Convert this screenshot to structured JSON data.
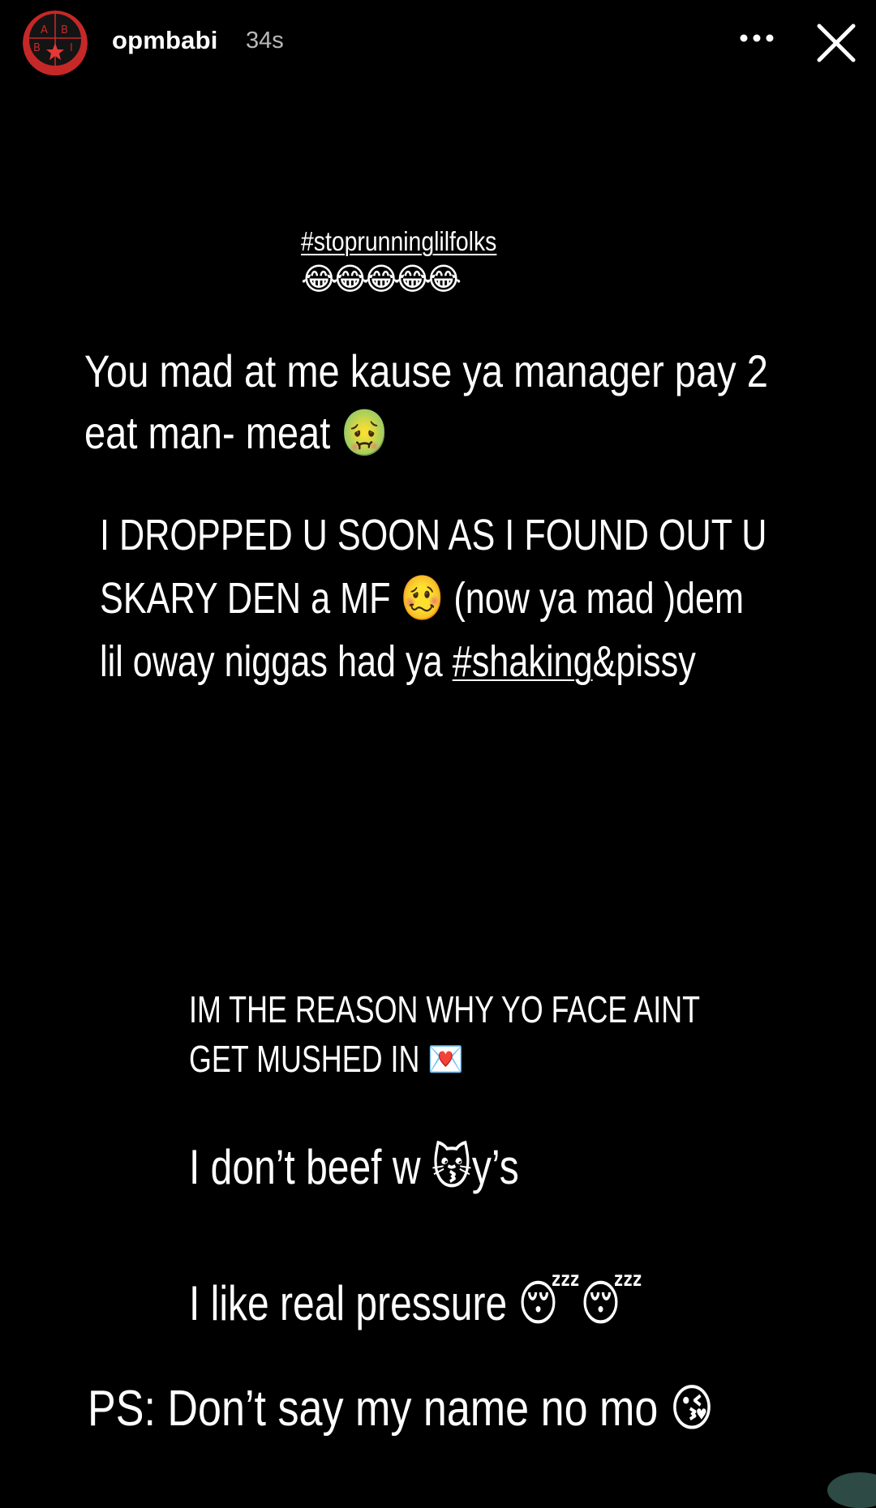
{
  "header": {
    "avatar_letters": [
      "A",
      "B",
      "B",
      "I"
    ],
    "username": "opmbabi",
    "timestamp": "34s",
    "more_label": "•••"
  },
  "colors": {
    "background": "#000000",
    "text": "#ffffff",
    "avatar_red": "#c62828",
    "avatar_dark": "#1a1a1a",
    "avatar_star": "#e53935"
  },
  "story": {
    "hashtag_top": "#stoprunninglilfolks",
    "emoji_row": "😂😂😂😂😂",
    "block_a": {
      "line1": "You mad at me kause ya manager pay 2",
      "line2_text": "eat man- meat ",
      "line2_emoji": "🤢"
    },
    "block_b": {
      "line1": "I DROPPED U SOON AS I FOUND OUT U",
      "line2_pre": "SKARY DEN a MF ",
      "line2_emoji": "🥴",
      "line2_post": " (now ya mad )dem",
      "line3_pre": "lil oway niggas had ya  ",
      "line3_hashtag": "#shaking",
      "line3_post": "&pissy"
    },
    "block_c": {
      "line1": "IM THE  REASON  WHY YO FACE AINT",
      "line2_text": "GET MUSHED IN ",
      "line2_emoji": "💌"
    },
    "block_d": {
      "pre": "I don’t beef w ",
      "emoji": "😽",
      "post": "y’s"
    },
    "block_e": {
      "text": "I like real pressure ",
      "emoji": "😴😴"
    },
    "block_f": {
      "text": "PS: Don’t say my name no mo ",
      "emoji": "😘"
    }
  }
}
